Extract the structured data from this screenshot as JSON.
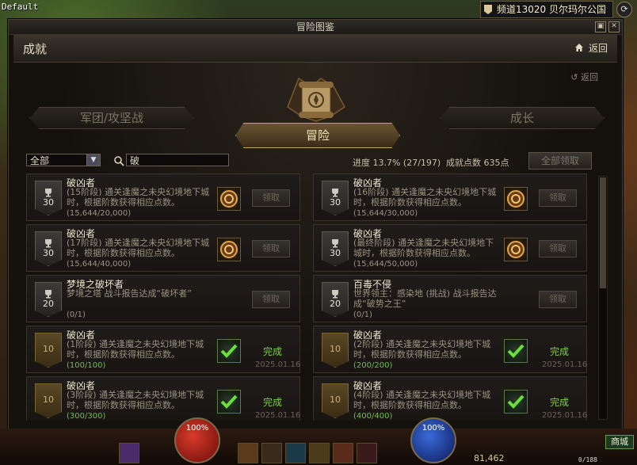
{
  "hud": {
    "default_label": "Default",
    "channel": "频道13020 贝尔玛尔公国",
    "hp_percent": "100%",
    "mp_percent": "100%",
    "coins": "81,462",
    "inventory": "0/188",
    "shop_label": "商城"
  },
  "window": {
    "title": "冒险图鉴",
    "section_title": "成就",
    "back_label": "返回",
    "sub_back_label": "返回"
  },
  "tabs": {
    "left": "军团/攻坚战",
    "active": "冒险",
    "right": "成长"
  },
  "filter": {
    "category": "全部",
    "search_value": "破",
    "progress": "进度 13.7% (27/197)",
    "points": "成就点数 635点",
    "claim_all": "全部领取"
  },
  "cards": [
    {
      "title": "破凶者",
      "desc": "(15阶段) 通关逢魔之未央幻境地下城时，根据阶数获得相应点数。",
      "count": "(15,644/20,000)",
      "points": "30",
      "status": "claim",
      "button": "领取",
      "date": ""
    },
    {
      "title": "破凶者",
      "desc": "(16阶段) 通关逢魔之未央幻境地下城时，根据阶数获得相应点数。",
      "count": "(15,644/30,000)",
      "points": "30",
      "status": "claim",
      "button": "领取",
      "date": ""
    },
    {
      "title": "破凶者",
      "desc": "(17阶段) 通关逢魔之未央幻境地下城时，根据阶数获得相应点数。",
      "count": "(15,644/40,000)",
      "points": "30",
      "status": "claim",
      "button": "领取",
      "date": ""
    },
    {
      "title": "破凶者",
      "desc": "(最终阶段) 通关逢魔之未央幻境地下城时，根据阶数获得相应点数。",
      "count": "(15,644/50,000)",
      "points": "30",
      "status": "claim",
      "button": "领取",
      "date": ""
    },
    {
      "title": "梦境之破坏者",
      "desc": "梦境之塔 战斗报告达成“破坏者”",
      "count": "(0/1)",
      "points": "20",
      "status": "claim",
      "button": "领取",
      "date": ""
    },
    {
      "title": "百毒不侵",
      "desc": "世界领主：感染地 (挑战) 战斗报告达成“破势之王”",
      "count": "(0/1)",
      "points": "20",
      "status": "claim",
      "button": "领取",
      "date": ""
    },
    {
      "title": "破凶者",
      "desc": "(1阶段) 通关逢魔之未央幻境地下城时，根据阶数获得相应点数。",
      "count": "(100/100)",
      "points": "10",
      "status": "done",
      "button": "完成",
      "date": "2025.01.16"
    },
    {
      "title": "破凶者",
      "desc": "(2阶段) 通关逢魔之未央幻境地下城时，根据阶数获得相应点数。",
      "count": "(200/200)",
      "points": "10",
      "status": "done",
      "button": "完成",
      "date": "2025.01.16"
    },
    {
      "title": "破凶者",
      "desc": "(3阶段) 通关逢魔之未央幻境地下城时，根据阶数获得相应点数。",
      "count": "(300/300)",
      "points": "10",
      "status": "done",
      "button": "完成",
      "date": "2025.01.16"
    },
    {
      "title": "破凶者",
      "desc": "(4阶段) 通关逢魔之未央幻境地下城时，根据阶数获得相应点数。",
      "count": "(400/400)",
      "points": "10",
      "status": "done",
      "button": "完成",
      "date": "2025.01.16"
    }
  ]
}
